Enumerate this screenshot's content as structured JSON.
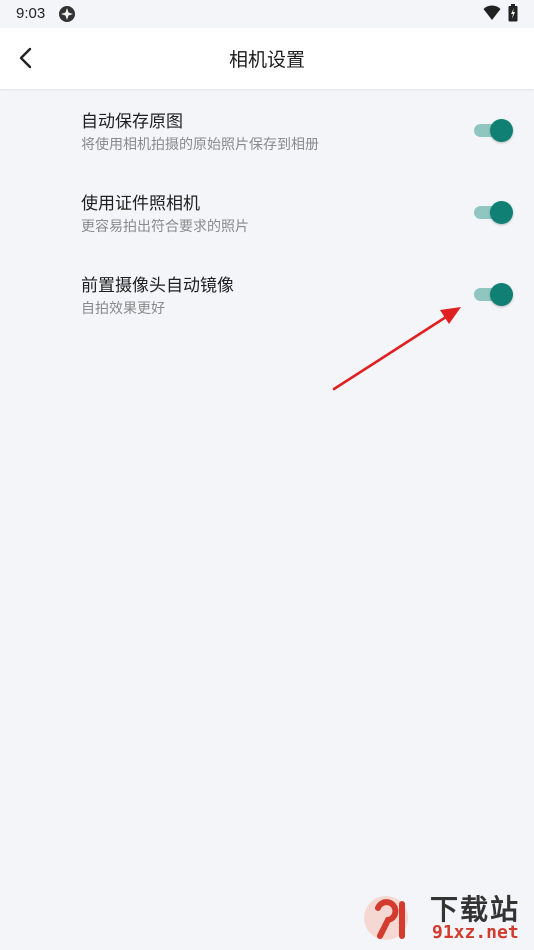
{
  "status_bar": {
    "time": "9:03",
    "icons": [
      "app-notification-icon",
      "wifi-icon",
      "battery-charging-icon"
    ]
  },
  "header": {
    "title": "相机设置",
    "back_icon": "chevron-left-icon"
  },
  "settings": [
    {
      "title": "自动保存原图",
      "subtitle": "将使用相机拍摄的原始照片保存到相册",
      "enabled": true
    },
    {
      "title": "使用证件照相机",
      "subtitle": "更容易拍出符合要求的照片",
      "enabled": true
    },
    {
      "title": "前置摄像头自动镜像",
      "subtitle": "自拍效果更好",
      "enabled": true
    }
  ],
  "annotation": {
    "type": "arrow",
    "color": "#e02020",
    "points_to": "前置摄像头自动镜像 toggle"
  },
  "watermark": {
    "title": "下载站",
    "url": "91xz.net"
  },
  "colors": {
    "background": "#f4f5f9",
    "toggle_thumb": "#0f8073",
    "toggle_track": "#8fc7c0",
    "watermark_red": "#d23b2d"
  }
}
